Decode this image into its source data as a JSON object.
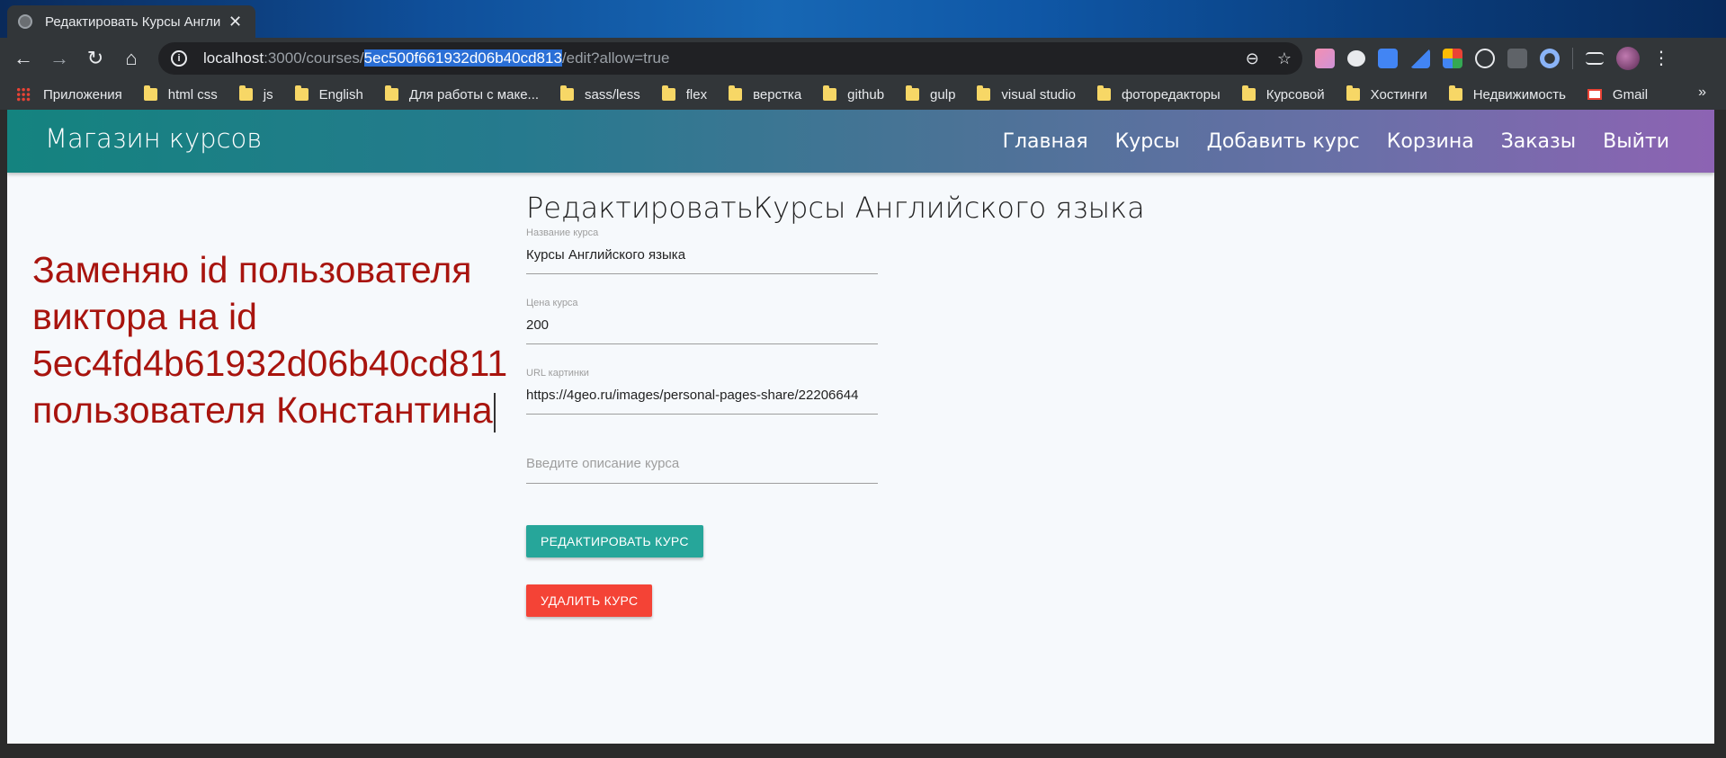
{
  "browser": {
    "tab_title": "Редактировать Курсы Англи",
    "tab_close": "✕",
    "url": {
      "host": "localhost",
      "port_path": ":3000/courses/",
      "selected": "5ec500f661932d06b40cd813",
      "rest": "/edit?allow=true"
    },
    "nav": {
      "back": "←",
      "forward": "→",
      "reload": "↻",
      "home": "⌂"
    },
    "omnibox_icons": {
      "zoom": "⊖",
      "star": "☆"
    },
    "bookmarks": [
      "Приложения",
      "html css",
      "js",
      "English",
      "Для работы с маке...",
      "sass/less",
      "flex",
      "верстка",
      "github",
      "gulp",
      "visual studio",
      "фоторедакторы",
      "Курсовой",
      "Хостинги",
      "Недвижимость",
      "Gmail"
    ],
    "bookmarks_more": "»"
  },
  "site": {
    "brand": "Магазин курсов",
    "nav": [
      "Главная",
      "Курсы",
      "Добавить курс",
      "Корзина",
      "Заказы",
      "Выйти"
    ]
  },
  "annotation": {
    "line1": "Заменяю id пользователя",
    "line2": "виктора на id",
    "line3": "5ec4fd4b61932d06b40cd811",
    "line4": "пользователя Константина"
  },
  "form": {
    "title": "РедактироватьКурсы Английского языка",
    "name_label": "Название курса",
    "name_value": "Курсы Английского языка",
    "price_label": "Цена курса",
    "price_value": "200",
    "img_label": "URL картинки",
    "img_value": "https://4geo.ru/images/personal-pages-share/22206644",
    "desc_placeholder": "Введите описание курса",
    "edit_button": "РЕДАКТИРОВАТЬ КУРС",
    "delete_button": "УДАЛИТЬ КУРС"
  },
  "colors": {
    "accent_teal": "#26a69a",
    "danger_red": "#f44336",
    "annotation_red": "#a8140e"
  }
}
